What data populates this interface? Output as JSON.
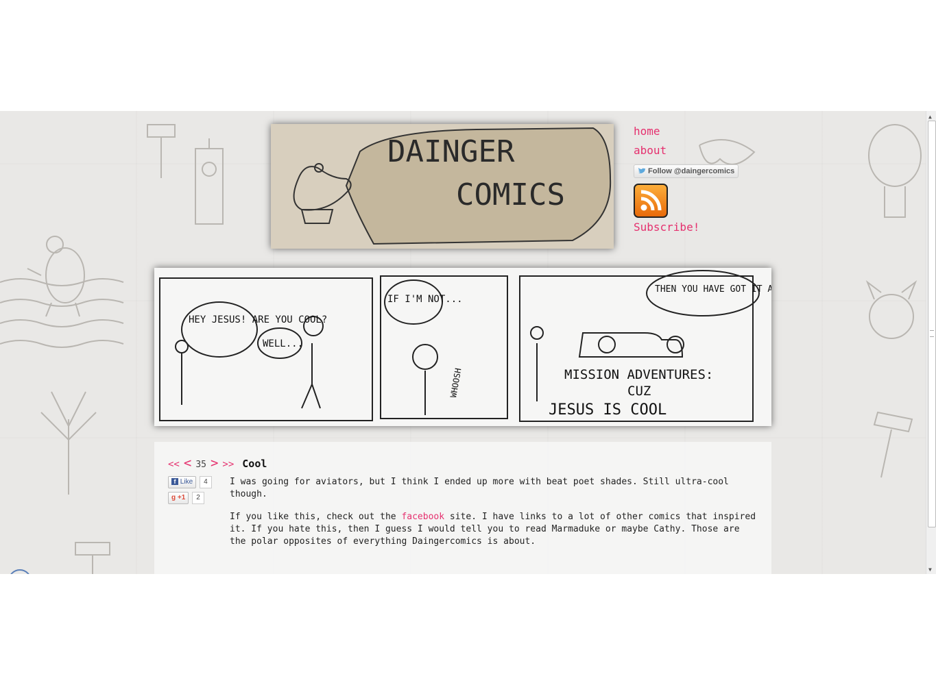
{
  "site": {
    "logo_text_line1": "DAINGER",
    "logo_text_line2": "COMICS"
  },
  "nav": {
    "home": "home",
    "about": "about",
    "twitter_follow": "Follow @daingercomics",
    "subscribe": "Subscribe!"
  },
  "comic": {
    "panel1_speech1": "HEY JESUS! ARE YOU COOL?",
    "panel1_speech2": "WELL...",
    "panel2_speech": "IF I'M NOT...",
    "panel2_sfx": "WHOOSH",
    "panel3_speech": "THEN YOU HAVE GOT IT ALL WRONG",
    "panel3_caption1": "MISSION ADVENTURES:",
    "panel3_caption2": "CUZ",
    "panel3_caption3": "JESUS IS COOL"
  },
  "post_nav": {
    "first": "<<",
    "prev": "<",
    "number": "35",
    "next": ">",
    "last": ">>",
    "title": "Cool"
  },
  "social": {
    "fb_label": "Like",
    "fb_count": "4",
    "gplus_label": "+1",
    "gplus_count": "2"
  },
  "post": {
    "para1": "I was going for aviators, but I think I ended up more with beat poet shades. Still ultra-cool though.",
    "para2_before": "If you like this, check out the ",
    "para2_link": "facebook",
    "para2_after": " site. I have links to a lot of other comics that inspired it. If you hate this, then I guess I would tell you to read Marmaduke or maybe Cathy. Those are the polar opposites of everything Daingercomics is about."
  },
  "colors": {
    "link": "#e5306e",
    "background": "#e9e8e6"
  }
}
